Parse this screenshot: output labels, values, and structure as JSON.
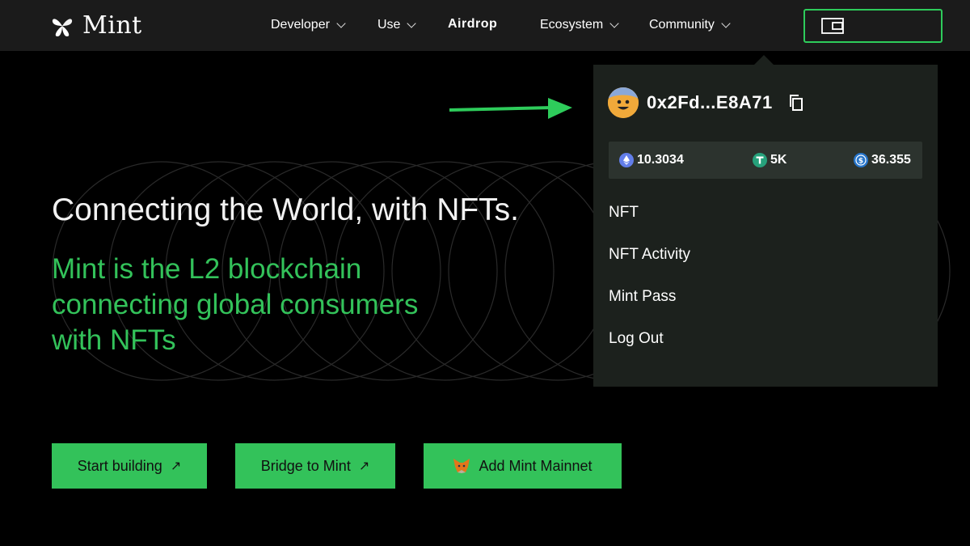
{
  "header": {
    "logo_text": "Mint",
    "nav": [
      {
        "label": "Developer"
      },
      {
        "label": "Use"
      },
      {
        "label": "Airdrop"
      },
      {
        "label": "Ecosystem"
      },
      {
        "label": "Community"
      }
    ]
  },
  "hero": {
    "title": "Connecting the World, with NFTs.",
    "subtitle": "Mint is the L2 blockchain connecting global consumers with NFTs",
    "buttons": [
      {
        "label": "Start building"
      },
      {
        "label": "Bridge to Mint"
      },
      {
        "label": "Add Mint Mainnet"
      }
    ]
  },
  "wallet_menu": {
    "address": "0x2Fd...E8A71",
    "balances": [
      {
        "token_icon": "eth-icon",
        "value": "10.3034"
      },
      {
        "token_icon": "usdt-icon",
        "value": "5K"
      },
      {
        "token_icon": "usdc-icon",
        "value": "36.355"
      }
    ],
    "items": [
      {
        "label": "NFT"
      },
      {
        "label": "NFT Activity"
      },
      {
        "label": "Mint Pass"
      },
      {
        "label": "Log Out"
      }
    ]
  },
  "colors": {
    "accent": "#33c25a",
    "header_bg": "#1b1b1b",
    "dropdown_bg": "#1c211d"
  }
}
